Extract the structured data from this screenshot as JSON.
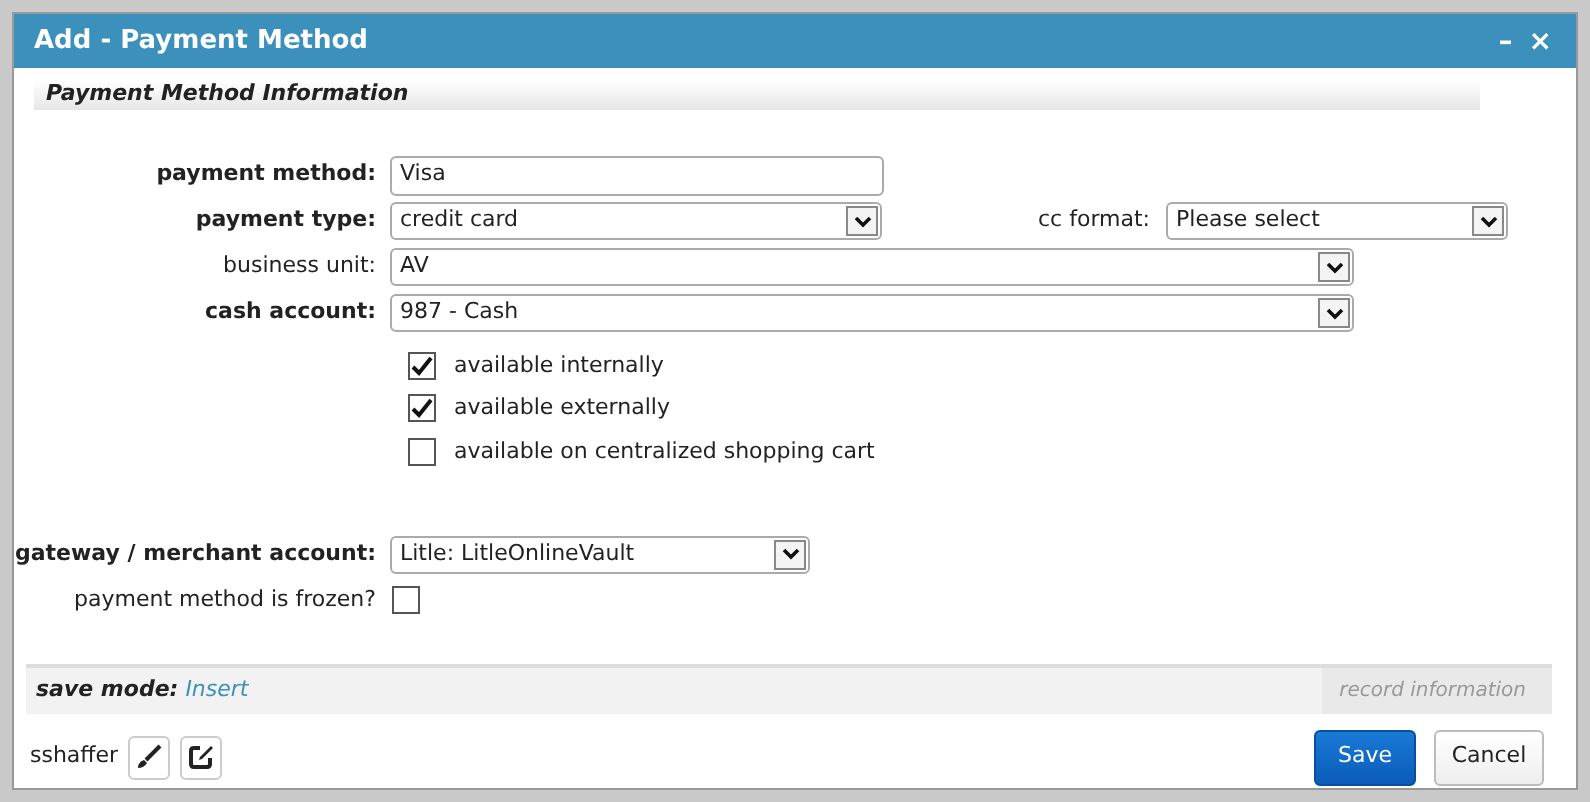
{
  "window": {
    "title": "Add - Payment Method",
    "controls": [
      "–",
      "×"
    ]
  },
  "section": {
    "title": "Payment Method Information"
  },
  "fields": [
    {
      "label": "payment method:",
      "strong": true,
      "kind": "text",
      "value": "Visa"
    },
    {
      "label": "payment type:",
      "strong": true,
      "kind": "select",
      "value": "credit card",
      "extra": {
        "label": "cc format:",
        "strong": false,
        "kind": "select",
        "value": "Please select"
      }
    },
    {
      "label": "business unit:",
      "strong": false,
      "kind": "select",
      "value": "AV"
    },
    {
      "label": "cash account:",
      "strong": true,
      "kind": "select",
      "value": "987 - Cash"
    }
  ],
  "options": [
    {
      "label": "available internally",
      "checked": true
    },
    {
      "label": "available externally",
      "checked": true
    },
    {
      "label": "available on centralized shopping cart",
      "checked": false
    }
  ],
  "gateway": [
    {
      "label": "gateway / merchant account:",
      "strong": true,
      "kind": "select",
      "value": "Litle: LitleOnlineVault"
    },
    {
      "label": "payment method is frozen?",
      "strong": false,
      "kind": "checkbox",
      "checked": false
    }
  ],
  "save_mode": {
    "label": "save mode:",
    "value": "Insert",
    "record_info": "record information"
  },
  "footer": {
    "user": "sshaffer",
    "buttons": [
      {
        "label": "Save",
        "primary": true
      },
      {
        "label": "Cancel",
        "primary": false
      }
    ]
  }
}
